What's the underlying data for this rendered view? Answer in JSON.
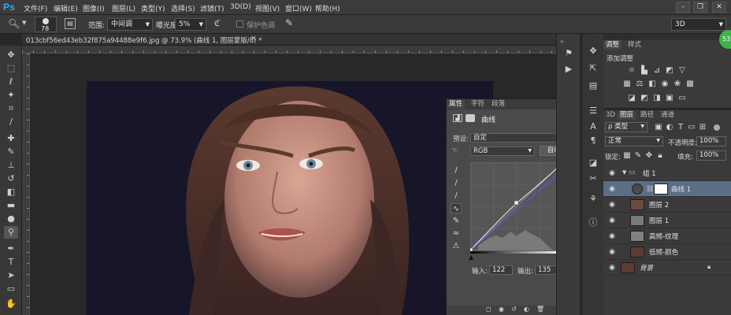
{
  "app": {
    "logo": "Ps"
  },
  "menu": [
    "文件(F)",
    "编辑(E)",
    "图像(I)",
    "图层(L)",
    "类型(Y)",
    "选择(S)",
    "滤镜(T)",
    "3D(D)",
    "视图(V)",
    "窗口(W)",
    "帮助(H)"
  ],
  "window_controls": [
    "–",
    "❐",
    "✕"
  ],
  "options": {
    "brush_size": "78",
    "range_label": "范围:",
    "range_value": "中间调",
    "exposure_label": "曝光度:",
    "exposure_value": "5%",
    "protect_label": "保护色调",
    "workspace": "3D"
  },
  "document": {
    "tab_title": "013cbf56ed43eb32f875a94488e9f6.jpg @ 73.9% (曲线 1, 图层蒙版/8) *"
  },
  "tools": [
    "move-tool-icon",
    "marquee-icon",
    "lasso-icon",
    "quick-select-icon",
    "crop-icon",
    "eyedropper-icon",
    "healing-icon",
    "brush-icon",
    "stamp-icon",
    "history-brush-icon",
    "eraser-icon",
    "gradient-icon",
    "blur-icon",
    "dodge-icon",
    "pen-icon",
    "type-icon",
    "path-select-icon",
    "shape-icon",
    "hand-icon"
  ],
  "adjustments": {
    "tabs": [
      "调整",
      "样式"
    ],
    "title": "添加调整"
  },
  "properties": {
    "tabs": [
      "属性",
      "字符",
      "段落"
    ],
    "title": "曲线",
    "preset_label": "预设:",
    "preset_value": "自定",
    "channel_value": "RGB",
    "auto_label": "自动",
    "input_label": "输入:",
    "input_value": "122",
    "output_label": "输出:",
    "output_value": "135"
  },
  "layers": {
    "tabs": [
      "3D",
      "图层",
      "路径",
      "通道"
    ],
    "filter_label": "ρ 类型",
    "blend_mode": "正常",
    "opacity_label": "不透明度:",
    "opacity_value": "100%",
    "lock_label": "锁定:",
    "fill_label": "填充:",
    "fill_value": "100%",
    "items": [
      {
        "name": "组 1"
      },
      {
        "name": "曲线 1"
      },
      {
        "name": "图层 2"
      },
      {
        "name": "图层 1"
      },
      {
        "name": "高频-纹理"
      },
      {
        "name": "低频-颜色"
      },
      {
        "name": "背景"
      }
    ]
  },
  "badge": "53",
  "colors": {
    "accent": "#31a8ff",
    "selected_layer": "#5c6e86",
    "badge": "#3bb54a"
  }
}
